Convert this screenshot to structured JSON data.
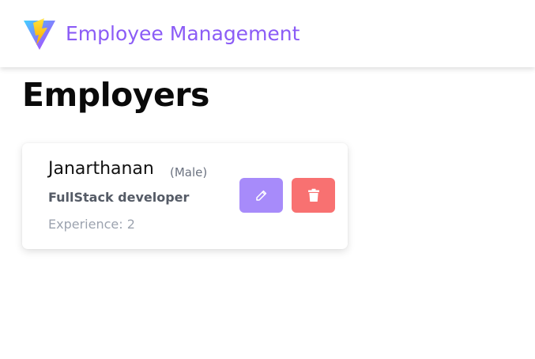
{
  "header": {
    "brand": "Employee Management",
    "logo_icon": "vite-lightning-logo-icon"
  },
  "page": {
    "title": "Employers"
  },
  "employees": [
    {
      "name": "Janarthanan",
      "gender": "(Male)",
      "role": "FullStack developer",
      "experience": "Experience: 2",
      "edit_icon": "pencil-icon",
      "delete_icon": "trash-icon"
    }
  ],
  "colors": {
    "accent": "#8b5cf6",
    "edit_button": "#a78bfa",
    "delete_button": "#f87171"
  }
}
